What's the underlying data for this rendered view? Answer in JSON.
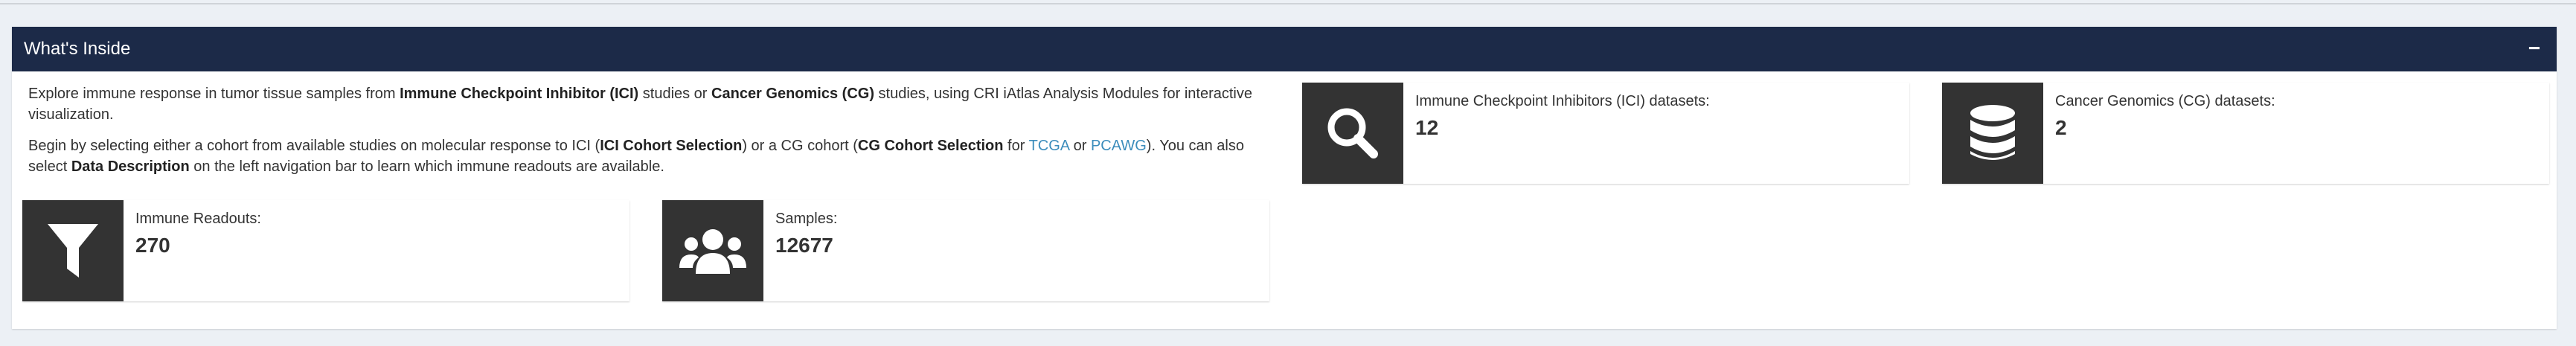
{
  "panel": {
    "title": "What's Inside",
    "collapse_symbol": "−"
  },
  "intro": {
    "p1": [
      {
        "text": "Explore immune response in tumor tissue samples from ",
        "style": "plain"
      },
      {
        "text": "Immune Checkpoint Inhibitor (ICI)",
        "style": "bold"
      },
      {
        "text": " studies or ",
        "style": "plain"
      },
      {
        "text": "Cancer Genomics (CG)",
        "style": "bold"
      },
      {
        "text": " studies, using CRI iAtlas Analysis Modules for interactive visualization.",
        "style": "plain"
      }
    ],
    "p2": [
      {
        "text": "Begin by selecting either a cohort from available studies on molecular response to ICI (",
        "style": "plain"
      },
      {
        "text": "ICI Cohort Selection",
        "style": "bold"
      },
      {
        "text": ") or a CG cohort (",
        "style": "plain"
      },
      {
        "text": "CG Cohort Selection",
        "style": "bold"
      },
      {
        "text": " for ",
        "style": "plain"
      },
      {
        "text": "TCGA",
        "style": "link"
      },
      {
        "text": " or ",
        "style": "plain"
      },
      {
        "text": "PCAWG",
        "style": "link"
      },
      {
        "text": "). You can also select ",
        "style": "plain"
      },
      {
        "text": "Data Description",
        "style": "bold"
      },
      {
        "text": " on the left navigation bar to learn which immune readouts are available.",
        "style": "plain"
      }
    ]
  },
  "stats": {
    "ici": {
      "label": "Immune Checkpoint Inhibitors (ICI) datasets:",
      "value": "12",
      "icon": "search-icon"
    },
    "cg": {
      "label": "Cancer Genomics (CG) datasets:",
      "value": "2",
      "icon": "database-icon"
    },
    "readouts": {
      "label": "Immune Readouts:",
      "value": "270",
      "icon": "filter-icon"
    },
    "samples": {
      "label": "Samples:",
      "value": "12677",
      "icon": "users-icon"
    }
  },
  "colors": {
    "header_bg": "#1c2a48",
    "icon_bg": "#333333",
    "link": "#3c8dbc",
    "page_bg": "#ecf0f5"
  }
}
